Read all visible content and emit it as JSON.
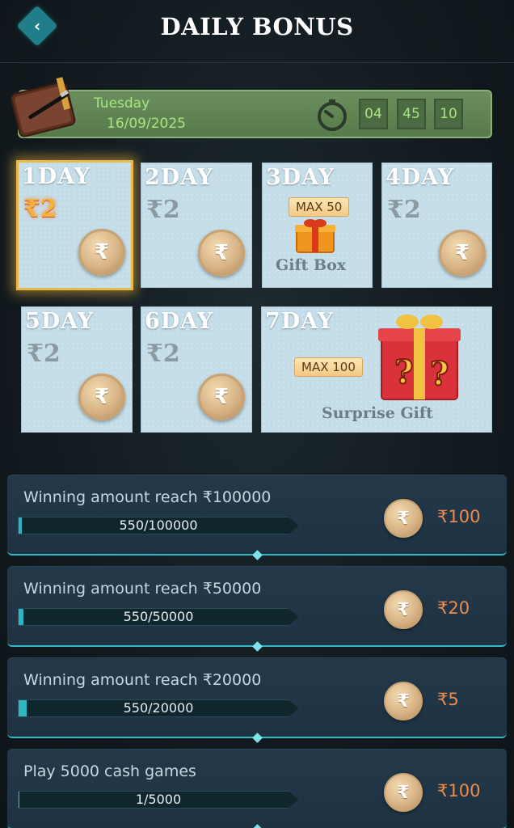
{
  "header": {
    "title": "DAILY BONUS",
    "back_icon": "chevron-left-icon"
  },
  "datebar": {
    "day": "Tuesday",
    "date": "16/09/2025",
    "timer": {
      "hours": "04",
      "minutes": "45",
      "seconds": "10"
    }
  },
  "days": [
    {
      "label": "1DAY",
      "amount": "₹2",
      "active": true
    },
    {
      "label": "2DAY",
      "amount": "₹2"
    },
    {
      "label": "3DAY",
      "max": "MAX 50",
      "caption": "Gift Box"
    },
    {
      "label": "4DAY",
      "amount": "₹2"
    },
    {
      "label": "5DAY",
      "amount": "₹2"
    },
    {
      "label": "6DAY",
      "amount": "₹2"
    },
    {
      "label": "7DAY",
      "max": "MAX 100",
      "caption": "Surprise Gift"
    }
  ],
  "coin_symbol": "₹",
  "tasks": [
    {
      "title": "Winning amount reach ₹100000",
      "progress_text": "550/100000",
      "progress": 0.0055,
      "reward": "₹100"
    },
    {
      "title": "Winning amount reach ₹50000",
      "progress_text": "550/50000",
      "progress": 0.011,
      "reward": "₹20"
    },
    {
      "title": "Winning amount reach ₹20000",
      "progress_text": "550/20000",
      "progress": 0.0275,
      "reward": "₹5"
    },
    {
      "title": "Play 5000 cash games",
      "progress_text": "1/5000",
      "progress": 0.0002,
      "reward": "₹100"
    }
  ],
  "colors": {
    "accent": "#2bb6c1",
    "reward": "#f08a4b",
    "date_text": "#a6e57f",
    "active_border": "#e8b94a"
  }
}
